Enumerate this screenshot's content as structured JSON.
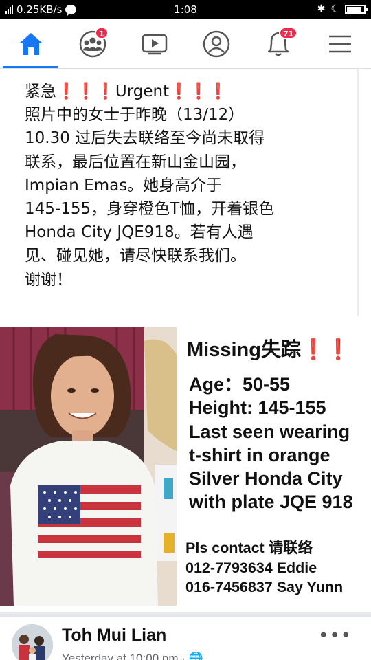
{
  "status_bar": {
    "speed": "0.25KB/s",
    "time": "1:08",
    "battery_level": 0.8
  },
  "nav": {
    "tabs": [
      {
        "name": "home",
        "icon": "home-icon",
        "active": true
      },
      {
        "name": "friends",
        "icon": "friends-icon",
        "badge": "1"
      },
      {
        "name": "watch",
        "icon": "video-icon"
      },
      {
        "name": "profile",
        "icon": "profile-icon"
      },
      {
        "name": "notifications",
        "icon": "bell-icon",
        "badge": "71"
      },
      {
        "name": "menu",
        "icon": "hamburger-icon"
      }
    ],
    "accent": "#1877f2",
    "badge_color": "#f02849"
  },
  "post": {
    "lines": [
      {
        "pre": "紧急",
        "excl": "❗❗❗",
        "mid": "Urgent",
        "excl2": "❗❗❗"
      },
      {
        "text": "照片中的女士于昨晚（13/12）"
      },
      {
        "text": "10.30 过后失去联络至今尚未取得"
      },
      {
        "text": "联系，最后位置在新山金山园，"
      },
      {
        "text": "Impian Emas。她身高介于"
      },
      {
        "text": "145-155，身穿橙色T恤，开着银色"
      },
      {
        "text": "Honda City JQE918。若有人遇"
      },
      {
        "text": "见、碰见她，请尽快联系我们。"
      },
      {
        "text": "谢谢！"
      }
    ]
  },
  "poster": {
    "title": "Missing失踪",
    "title_excl": "❗❗",
    "lines": [
      "Age：50-55",
      "Height: 145-155",
      "Last seen wearing",
      "t-shirt in orange",
      "Silver Honda City",
      "with plate JQE 918"
    ],
    "contact": [
      "Pls contact 请联络",
      "012-7793634 Eddie",
      "016-7456837 Say Yunn"
    ]
  },
  "author": {
    "name": "Toh Mui Lian",
    "time": "Yesterday at 10:00 pm · 🌐",
    "more": "•••"
  }
}
